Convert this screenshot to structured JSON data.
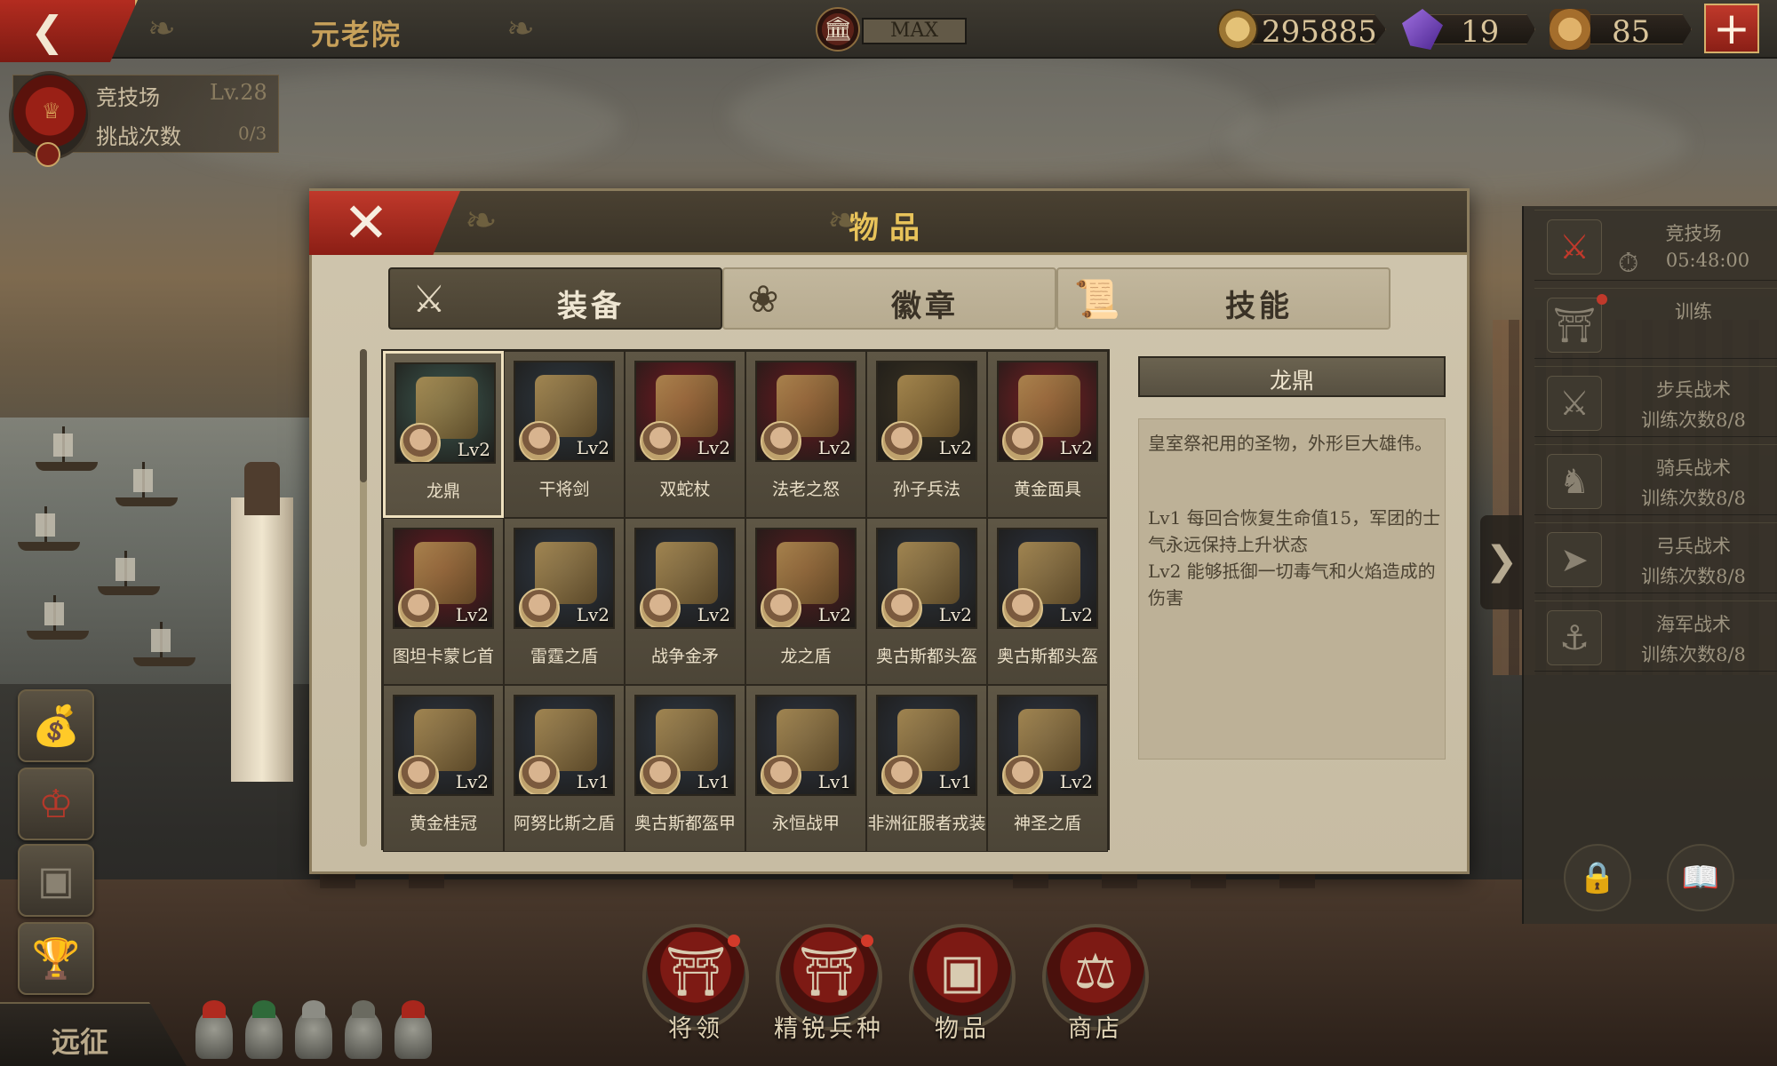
{
  "topbar": {
    "title": "元老院",
    "building_level": "MAX",
    "resources": [
      {
        "name": "gold",
        "icon": "gold-coin-icon",
        "value": "295885",
        "color": "#b88e3c"
      },
      {
        "name": "gems",
        "icon": "purple-gem-icon",
        "value": "19",
        "color": "#6c3fb0"
      },
      {
        "name": "spqr",
        "icon": "spqr-eagle-icon",
        "value": "85",
        "color": "#c28a3a"
      }
    ]
  },
  "arena": {
    "name": "竞技场",
    "level": "Lv.28",
    "tries_label": "挑战次数",
    "tries_value": "0/3"
  },
  "left_menu": {
    "expedition_label": "远征"
  },
  "dialog": {
    "title": "物品",
    "tabs": [
      {
        "label": "装备",
        "icon": "equipment-icon",
        "active": true
      },
      {
        "label": "徽章",
        "icon": "badge-icon",
        "active": false
      },
      {
        "label": "技能",
        "icon": "skill-scroll-icon",
        "active": false
      }
    ],
    "items": [
      {
        "name": "龙鼎",
        "level": "Lv2",
        "color": "#3e5b52"
      },
      {
        "name": "干将剑",
        "level": "Lv2",
        "color": "#2f3a44"
      },
      {
        "name": "双蛇杖",
        "level": "Lv2",
        "color": "#7a1a22"
      },
      {
        "name": "法老之怒",
        "level": "Lv2",
        "color": "#6e1a20"
      },
      {
        "name": "孙子兵法",
        "level": "Lv2",
        "color": "#3c3424"
      },
      {
        "name": "黄金面具",
        "level": "Lv2",
        "color": "#7c1f24"
      },
      {
        "name": "图坦卡蒙匕首",
        "level": "Lv2",
        "color": "#6b1a22"
      },
      {
        "name": "雷霆之盾",
        "level": "Lv2",
        "color": "#2f3a48"
      },
      {
        "name": "战争金矛",
        "level": "Lv2",
        "color": "#2c3440"
      },
      {
        "name": "龙之盾",
        "level": "Lv2",
        "color": "#5a1c20"
      },
      {
        "name": "奥古斯都头盔",
        "level": "Lv2",
        "color": "#2e3640"
      },
      {
        "name": "奥古斯都头盔",
        "level": "Lv2",
        "color": "#2c3340"
      },
      {
        "name": "黄金桂冠",
        "level": "Lv2",
        "color": "#2e3642"
      },
      {
        "name": "阿努比斯之盾",
        "level": "Lv1",
        "color": "#2c3644"
      },
      {
        "name": "奥古斯都盔甲",
        "level": "Lv1",
        "color": "#2f3a48"
      },
      {
        "name": "永恒战甲",
        "level": "Lv1",
        "color": "#2e3644"
      },
      {
        "name": "非洲征服者戎装",
        "level": "Lv1",
        "color": "#2c3440"
      },
      {
        "name": "神圣之盾",
        "level": "Lv2",
        "color": "#2e3644"
      }
    ],
    "selected_index": 0,
    "detail": {
      "name": "龙鼎",
      "description": "皇室祭祀用的圣物，外形巨大雄伟。",
      "levels": [
        "Lv1 每回合恢复生命值15，军团的士气永远保持上升状态",
        "Lv2 能够抵御一切毒气和火焰造成的伤害"
      ]
    }
  },
  "right_panel": {
    "items": [
      {
        "title": "竞技场",
        "sub": "05:48:00",
        "icon": "crossed-swords-icon"
      },
      {
        "title": "训练",
        "sub": "",
        "icon": "spartan-helmet-icon"
      },
      {
        "title": "步兵战术",
        "sub": "训练次数8/8",
        "icon": "sword-icon"
      },
      {
        "title": "骑兵战术",
        "sub": "训练次数8/8",
        "icon": "horse-icon"
      },
      {
        "title": "弓兵战术",
        "sub": "训练次数8/8",
        "icon": "bow-icon"
      },
      {
        "title": "海军战术",
        "sub": "训练次数8/8",
        "icon": "anchor-icon"
      }
    ]
  },
  "bottom_nav": [
    {
      "label": "将领",
      "icon": "general-helmet-icon"
    },
    {
      "label": "精锐兵种",
      "icon": "elite-helmet-icon"
    },
    {
      "label": "物品",
      "icon": "items-chest-icon"
    },
    {
      "label": "商店",
      "icon": "shop-scales-icon"
    }
  ]
}
